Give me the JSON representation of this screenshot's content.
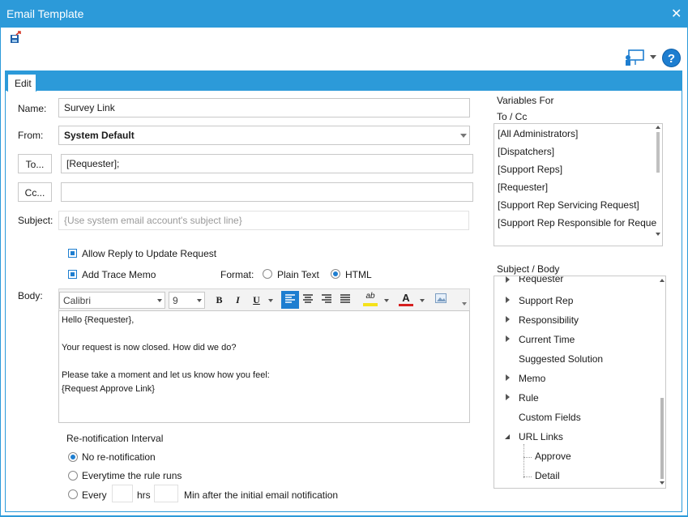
{
  "window": {
    "title": "Email Template",
    "close_glyph": "✕"
  },
  "toolbar": {
    "save_icon": "save-export-icon",
    "help_glyph": "?"
  },
  "tabs": [
    {
      "label": "Edit",
      "active": true
    }
  ],
  "form": {
    "name_label": "Name:",
    "name_value": "Survey Link",
    "from_label": "From:",
    "from_value": "System Default",
    "to_button": "To...",
    "to_value": "[Requester];",
    "cc_button": "Cc...",
    "cc_value": "",
    "subject_label": "Subject:",
    "subject_placeholder": "{Use system email account's subject line}",
    "allow_reply_label": "Allow Reply to Update Request",
    "allow_reply_checked": true,
    "add_trace_label": "Add Trace Memo",
    "add_trace_checked": true,
    "format_label": "Format:",
    "format_options": [
      "Plain Text",
      "HTML"
    ],
    "format_selected": "HTML",
    "body_label": "Body:"
  },
  "editor_toolbar": {
    "font": "Calibri",
    "size": "9",
    "bold": "B",
    "italic": "I",
    "underline": "U",
    "highlight": "ab",
    "font_color": "A"
  },
  "body_lines": [
    "Hello {Requester},",
    "",
    "Your request is now closed. How did we do?",
    "",
    "Please take a moment and let us know how you feel:",
    "{Request Approve Link}"
  ],
  "renotification": {
    "heading": "Re-notification Interval",
    "options": [
      {
        "label": "No re-notification",
        "selected": true
      },
      {
        "label": "Everytime the rule runs",
        "selected": false
      },
      {
        "label": "Every",
        "selected": false
      }
    ],
    "hrs_label": "hrs",
    "min_label": "Min after the initial email notification",
    "hrs_value": "",
    "min_value": ""
  },
  "variables": {
    "heading_line1": "Variables For",
    "heading_line2": "To / Cc",
    "items": [
      "[All Administrators]",
      "[Dispatchers]",
      "[Support Reps]",
      "[Requester]",
      "[Support Rep Servicing Request]",
      "[Support Rep Responsible for Reque"
    ]
  },
  "subject_body": {
    "heading": "Subject / Body",
    "tree": [
      {
        "label": "Requester",
        "expander": "collapsed",
        "depth": 0
      },
      {
        "label": "Support Rep",
        "expander": "collapsed",
        "depth": 0
      },
      {
        "label": "Responsibility",
        "expander": "collapsed",
        "depth": 0
      },
      {
        "label": "Current Time",
        "expander": "collapsed",
        "depth": 0
      },
      {
        "label": "Suggested Solution",
        "expander": "none",
        "depth": 0
      },
      {
        "label": "Memo",
        "expander": "collapsed",
        "depth": 0
      },
      {
        "label": "Rule",
        "expander": "collapsed",
        "depth": 0
      },
      {
        "label": "Custom Fields",
        "expander": "none",
        "depth": 0
      },
      {
        "label": "URL Links",
        "expander": "expanded",
        "depth": 0
      },
      {
        "label": "Approve",
        "expander": "none",
        "depth": 1
      },
      {
        "label": "Detail",
        "expander": "none",
        "depth": 1
      }
    ]
  },
  "colors": {
    "accent": "#2c9ad9",
    "selection": "#1e7ed0"
  }
}
